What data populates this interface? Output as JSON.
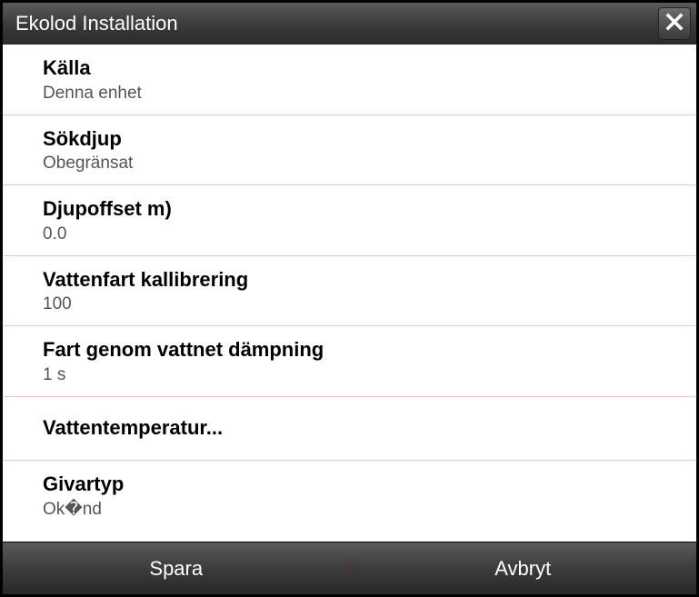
{
  "title": "Ekolod Installation",
  "items": [
    {
      "label": "Källa",
      "value": "Denna enhet"
    },
    {
      "label": "Sökdjup",
      "value": "Obegränsat"
    },
    {
      "label": "Djupoffset m)",
      "value": "0.0"
    },
    {
      "label": "Vattenfart kallibrering",
      "value": "100"
    },
    {
      "label": "Fart genom vattnet dämpning",
      "value": "1 s"
    },
    {
      "label": "Vattentemperatur...",
      "value": null
    },
    {
      "label": "Givartyp",
      "value": "Ok�nd"
    }
  ],
  "footer": {
    "save": "Spara",
    "cancel": "Avbryt"
  }
}
